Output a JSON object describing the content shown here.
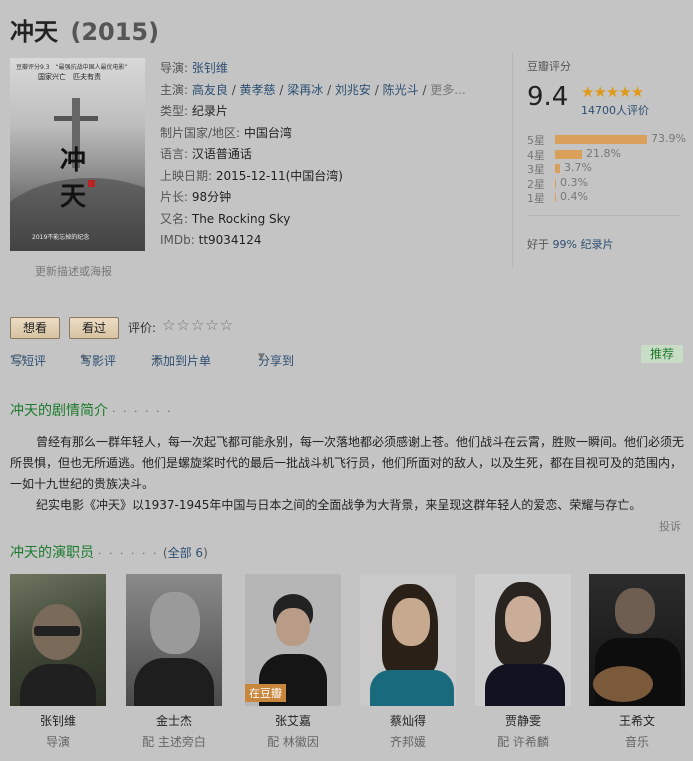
{
  "movie": {
    "title": "冲天",
    "year": "(2015)"
  },
  "poster": {
    "top_text": "豆瓣评分9.3　“最强抗战中国人最优电影”",
    "mid_text": "国家兴亡　匹夫有责",
    "char1": "冲",
    "char2": "天",
    "bottom_text": "2019不能忘掉的纪念",
    "update_link": "更新描述或海报"
  },
  "info": {
    "director_label": "导演: ",
    "director": "张钊维",
    "cast_label": "主演: ",
    "cast": [
      "高友良",
      "黄孝慈",
      "梁再冰",
      "刘兆安",
      "陈光斗"
    ],
    "cast_more": "更多...",
    "genre_label": "类型: ",
    "genre": "纪录片",
    "country_label": "制片国家/地区: ",
    "country": "中国台湾",
    "language_label": "语言: ",
    "language": "汉语普通话",
    "release_label": "上映日期: ",
    "release": "2015-12-11(中国台湾)",
    "runtime_label": "片长: ",
    "runtime": "98分钟",
    "aka_label": "又名: ",
    "aka": "The Rocking Sky",
    "imdb_label": "IMDb: ",
    "imdb": "tt9034124"
  },
  "rating": {
    "title": "豆瓣评分",
    "score": "9.4",
    "stars": "★★★★★",
    "count": "14700人评价",
    "breakdown": [
      {
        "label": "5星",
        "pct": "73.9%",
        "value": 73.9
      },
      {
        "label": "4星",
        "pct": "21.8%",
        "value": 21.8
      },
      {
        "label": "3星",
        "pct": "3.7%",
        "value": 3.7
      },
      {
        "label": "2星",
        "pct": "0.3%",
        "value": 0.3
      },
      {
        "label": "1星",
        "pct": "0.4%",
        "value": 0.4
      }
    ],
    "better_prefix": "好于 ",
    "better_value": "99% 纪录片"
  },
  "actions": {
    "want": "想看",
    "seen": "看过",
    "rate_label": "评价:",
    "empty_stars": "☆☆☆☆☆",
    "short_review": "写短评",
    "review": "写影评",
    "add_list": "添加到片单",
    "share": "分享到",
    "recommend": "推荐"
  },
  "icons": {
    "comment": "comment-icon",
    "pencil": "pencil-icon",
    "plus": "plus-icon",
    "caret": "caret-down-icon"
  },
  "synopsis": {
    "heading": "冲天的剧情简介",
    "dots": "· · · · · ·",
    "para1": "曾经有那么一群年轻人，每一次起飞都可能永别，每一次落地都必须感谢上苍。他们战斗在云霄，胜败一瞬间。他们必须无所畏惧，但也无所遁逃。他们是螺旋桨时代的最后一批战斗机飞行员，他们所面对的敌人，以及生死，都在目视可及的范围内，一如十九世纪的贵族决斗。",
    "para2": "纪实电影《冲天》以1937-1945年中国与日本之间的全面战争为大背景，来呈现这群年轻人的爱恋、荣耀与存亡。",
    "report": "投诉"
  },
  "cast_section": {
    "heading": "冲天的演职员",
    "dots": "· · · · · ·",
    "open_paren": "(",
    "all": "全部 6",
    "close_paren": ")",
    "onsite_badge": "在豆瓣",
    "members": [
      {
        "name": "张钊维",
        "role": "导演"
      },
      {
        "name": "金士杰",
        "role": "配 主述旁白"
      },
      {
        "name": "张艾嘉",
        "role": "配 林徽因"
      },
      {
        "name": "蔡灿得",
        "role": "齐邦媛"
      },
      {
        "name": "贾静雯",
        "role": "配 许希麟"
      },
      {
        "name": "王希文",
        "role": "音乐"
      }
    ]
  }
}
